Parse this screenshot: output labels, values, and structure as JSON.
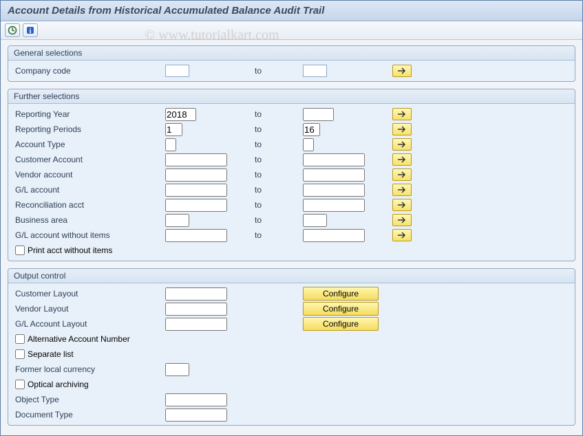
{
  "title": "Account Details from Historical Accumulated Balance Audit Trail",
  "toolbar": {
    "execute": "execute-icon",
    "info": "info-icon"
  },
  "watermark": "© www.tutorialkart.com",
  "common": {
    "to": "to",
    "configure": "Configure"
  },
  "groups": {
    "general": {
      "title": "General selections",
      "company_code": {
        "label": "Company code",
        "from": "",
        "to": ""
      }
    },
    "further": {
      "title": "Further selections",
      "reporting_year": {
        "label": "Reporting Year",
        "from": "2018",
        "to": ""
      },
      "reporting_periods": {
        "label": "Reporting Periods",
        "from": "1",
        "to": "16"
      },
      "account_type": {
        "label": "Account Type",
        "from": "",
        "to": ""
      },
      "customer_account": {
        "label": "Customer Account",
        "from": "",
        "to": ""
      },
      "vendor_account": {
        "label": "Vendor account",
        "from": "",
        "to": ""
      },
      "gl_account": {
        "label": "G/L account",
        "from": "",
        "to": ""
      },
      "reconciliation": {
        "label": "Reconciliation acct",
        "from": "",
        "to": ""
      },
      "business_area": {
        "label": "Business area",
        "from": "",
        "to": ""
      },
      "gl_no_items": {
        "label": "G/L account without items",
        "from": "",
        "to": ""
      },
      "print_no_items": {
        "label": "Print acct without items",
        "checked": false
      }
    },
    "output": {
      "title": "Output control",
      "customer_layout": {
        "label": "Customer Layout",
        "value": ""
      },
      "vendor_layout": {
        "label": "Vendor Layout",
        "value": ""
      },
      "gl_layout": {
        "label": "G/L Account Layout",
        "value": ""
      },
      "alt_account": {
        "label": "Alternative Account Number",
        "checked": false
      },
      "separate_list": {
        "label": "Separate list",
        "checked": false
      },
      "former_currency": {
        "label": "Former local currency",
        "value": ""
      },
      "optical_arch": {
        "label": "Optical archiving",
        "checked": false
      },
      "object_type": {
        "label": "Object Type",
        "value": ""
      },
      "document_type": {
        "label": "Document Type",
        "value": ""
      }
    }
  }
}
